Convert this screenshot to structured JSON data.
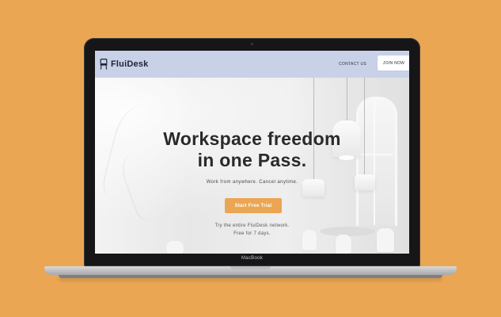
{
  "device": {
    "brand_label": "MacBook"
  },
  "site": {
    "logo_text": "FluiDesk",
    "nav": {
      "contact_label": "CONTACT US",
      "join_label": "JOIN NOW"
    },
    "hero": {
      "title_line1": "Workspace freedom",
      "title_line2": "in one Pass.",
      "subtitle": "Work from anywhere. Cancel anytime.",
      "cta_label": "Start Free Trial",
      "note_line1": "Try the entire FluiDesk network.",
      "note_line2": "Free for 7 days."
    }
  },
  "colors": {
    "background": "#eba653",
    "accent": "#eba653",
    "nav_bar": "#c8d1e7"
  },
  "icons": {
    "logo": "chair-icon"
  }
}
